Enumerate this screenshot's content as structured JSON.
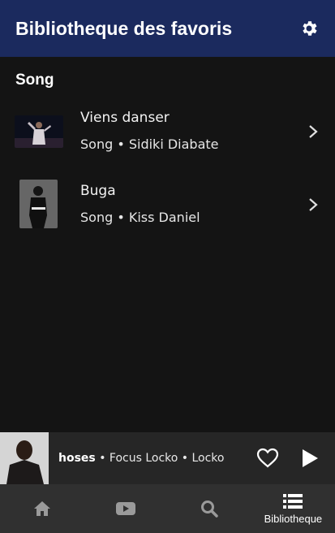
{
  "header": {
    "title": "Bibliotheque des favoris",
    "settings_icon": "gear-icon"
  },
  "section": {
    "heading": "Song"
  },
  "songs": [
    {
      "title": "Viens danser",
      "subtitle": "Song • Sidiki Diabate"
    },
    {
      "title": "Buga",
      "subtitle": "Song • Kiss Daniel"
    }
  ],
  "player": {
    "track": "hoses",
    "details": " • Focus Locko • Locko"
  },
  "nav": {
    "items": [
      {
        "icon": "home-icon",
        "label": ""
      },
      {
        "icon": "youtube-icon",
        "label": ""
      },
      {
        "icon": "search-icon",
        "label": ""
      },
      {
        "icon": "list-icon",
        "label": "Bibliotheque"
      }
    ]
  },
  "colors": {
    "header_bg": "#1b2a5e",
    "background": "#141414",
    "player_bg": "#262626",
    "nav_bg": "#303030",
    "inactive_icon": "#9a9a9a"
  }
}
